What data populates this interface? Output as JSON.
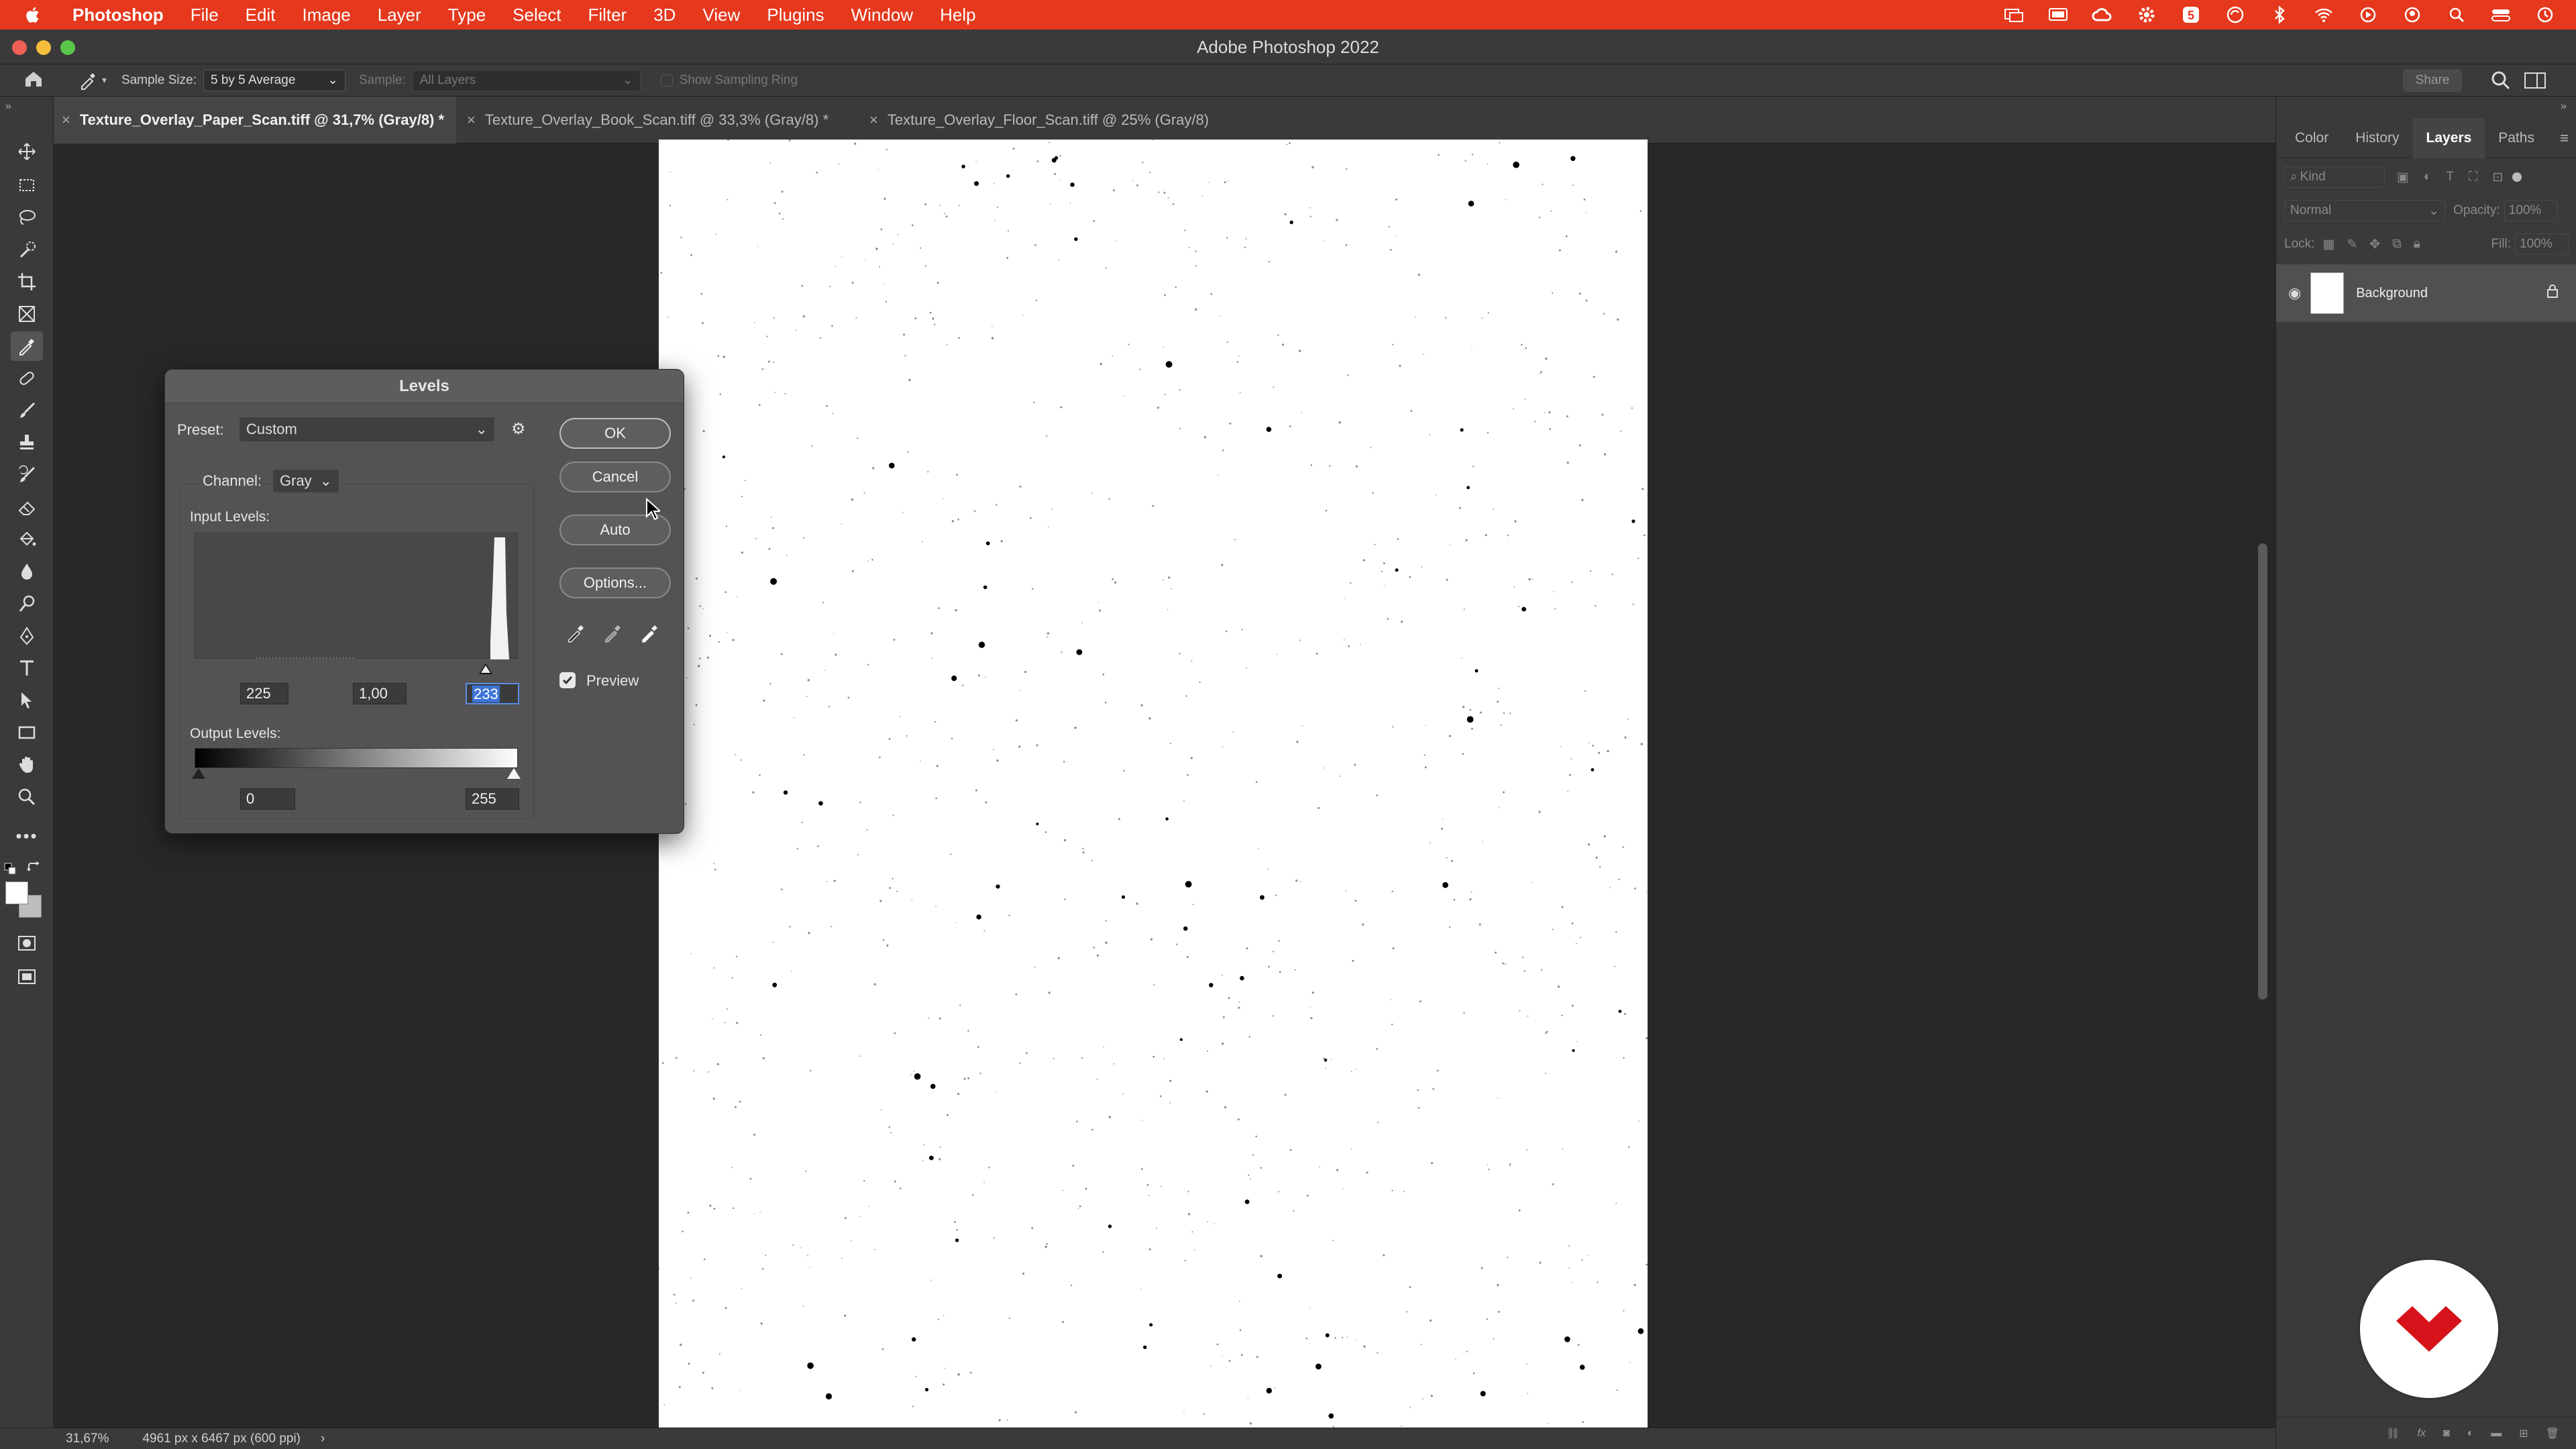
{
  "menubar": {
    "app": "Photoshop",
    "items": [
      "File",
      "Edit",
      "Image",
      "Layer",
      "Type",
      "Select",
      "Filter",
      "3D",
      "View",
      "Plugins",
      "Window",
      "Help"
    ]
  },
  "window": {
    "title": "Adobe Photoshop 2022"
  },
  "options_bar": {
    "sample_size_label": "Sample Size:",
    "sample_size_value": "5 by 5 Average",
    "sample_label": "Sample:",
    "sample_value": "All Layers",
    "show_ring_label": "Show Sampling Ring",
    "share_label": "Share"
  },
  "doc_tabs": [
    {
      "label": "Texture_Overlay_Paper_Scan.tiff @ 31,7% (Gray/8) *",
      "active": true
    },
    {
      "label": "Texture_Overlay_Book_Scan.tiff @ 33,3% (Gray/8) *",
      "active": false
    },
    {
      "label": "Texture_Overlay_Floor_Scan.tiff @ 25% (Gray/8)",
      "active": false
    }
  ],
  "status_bar": {
    "zoom": "31,67%",
    "doc_info": "4961 px x 6467 px (600 ppi)",
    "arrow": "›"
  },
  "panels": {
    "tabs": [
      "Color",
      "History",
      "Layers",
      "Paths"
    ],
    "active_tab": "Layers",
    "kind_placeholder": "Kind",
    "blend_mode": "Normal",
    "opacity_label": "Opacity:",
    "opacity_value": "100%",
    "lock_label": "Lock:",
    "fill_label": "Fill:",
    "fill_value": "100%",
    "layer_name": "Background"
  },
  "levels_dialog": {
    "title": "Levels",
    "preset_label": "Preset:",
    "preset_value": "Custom",
    "channel_label": "Channel:",
    "channel_value": "Gray",
    "input_levels_label": "Input Levels:",
    "input_black": "225",
    "input_gamma": "1,00",
    "input_white": "233",
    "output_levels_label": "Output Levels:",
    "output_black": "0",
    "output_white": "255",
    "buttons": {
      "ok": "OK",
      "cancel": "Cancel",
      "auto": "Auto",
      "options": "Options..."
    },
    "preview_label": "Preview",
    "preview_checked": true
  },
  "colors": {
    "menubar_bg": "#e5381d",
    "brand_red": "#d6121a",
    "selection_blue": "#3d74d8"
  }
}
